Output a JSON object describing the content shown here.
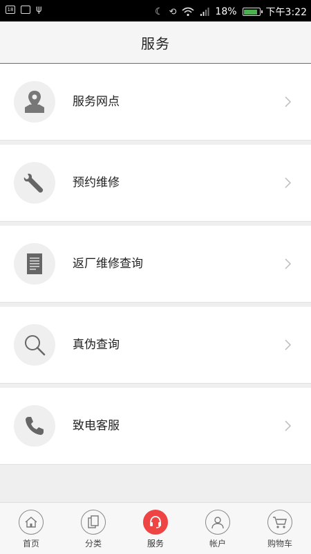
{
  "status": {
    "battery": "18%",
    "time": "下午3:22"
  },
  "header": {
    "title": "服务"
  },
  "items": [
    {
      "label": "服务网点",
      "icon": "map-pin-icon"
    },
    {
      "label": "预约维修",
      "icon": "wrench-icon"
    },
    {
      "label": "返厂维修查询",
      "icon": "document-icon"
    },
    {
      "label": "真伪查询",
      "icon": "magnifier-icon"
    },
    {
      "label": "致电客服",
      "icon": "phone-icon"
    }
  ],
  "tabs": [
    {
      "label": "首页",
      "icon": "home-icon"
    },
    {
      "label": "分类",
      "icon": "category-icon"
    },
    {
      "label": "服务",
      "icon": "headset-icon",
      "active": true
    },
    {
      "label": "帐户",
      "icon": "user-icon"
    },
    {
      "label": "购物车",
      "icon": "cart-icon"
    }
  ],
  "colors": {
    "accent": "#ef4444",
    "divider": "#e53935"
  }
}
